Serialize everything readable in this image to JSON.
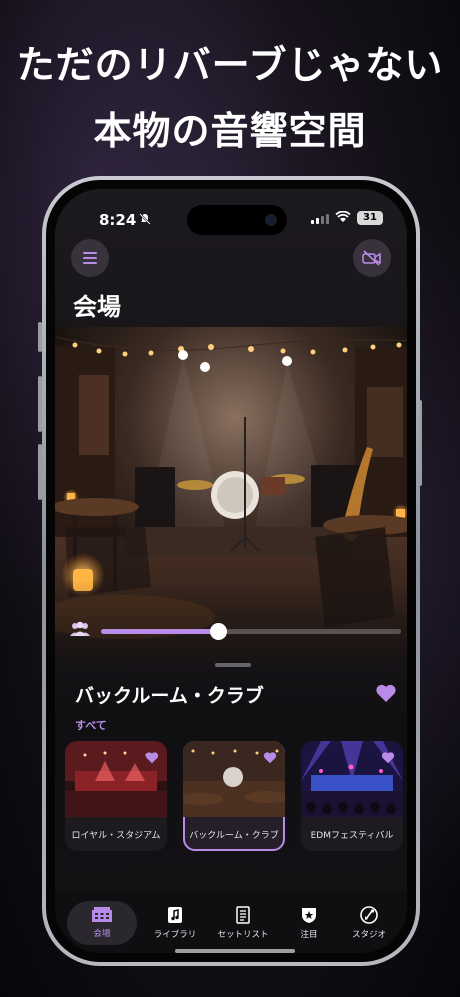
{
  "promo": {
    "headline_line1": "ただのリバーブじゃない",
    "headline_line2": "本物の音響空間"
  },
  "status_bar": {
    "time": "8:24",
    "battery": "31",
    "icons": [
      "bell-slash-icon",
      "signal-icon",
      "wifi-icon",
      "battery-icon"
    ]
  },
  "header": {
    "title": "会場",
    "menu_icon": "hamburger-menu-icon",
    "camera_icon": "video-off-icon"
  },
  "audience_slider": {
    "icon": "people-icon",
    "value": 0.39
  },
  "venue": {
    "name": "バックルーム・クラブ",
    "favorited": true,
    "filter_label": "すべて"
  },
  "venue_cards": [
    {
      "label": "ロイヤル・スタジアム",
      "selected": false,
      "favorited": true
    },
    {
      "label": "バックルーム・クラブ",
      "selected": true,
      "favorited": true
    },
    {
      "label": "EDMフェスティバル",
      "selected": false,
      "favorited": true
    }
  ],
  "tabs": [
    {
      "label": "会場",
      "icon": "building-icon",
      "active": true
    },
    {
      "label": "ライブラリ",
      "icon": "music-library-icon",
      "active": false
    },
    {
      "label": "セットリスト",
      "icon": "setlist-icon",
      "active": false
    },
    {
      "label": "注目",
      "icon": "star-pick-icon",
      "active": false
    },
    {
      "label": "スタジオ",
      "icon": "studio-icon",
      "active": false
    }
  ],
  "colors": {
    "accent": "#b98be8",
    "background": "#121114"
  }
}
